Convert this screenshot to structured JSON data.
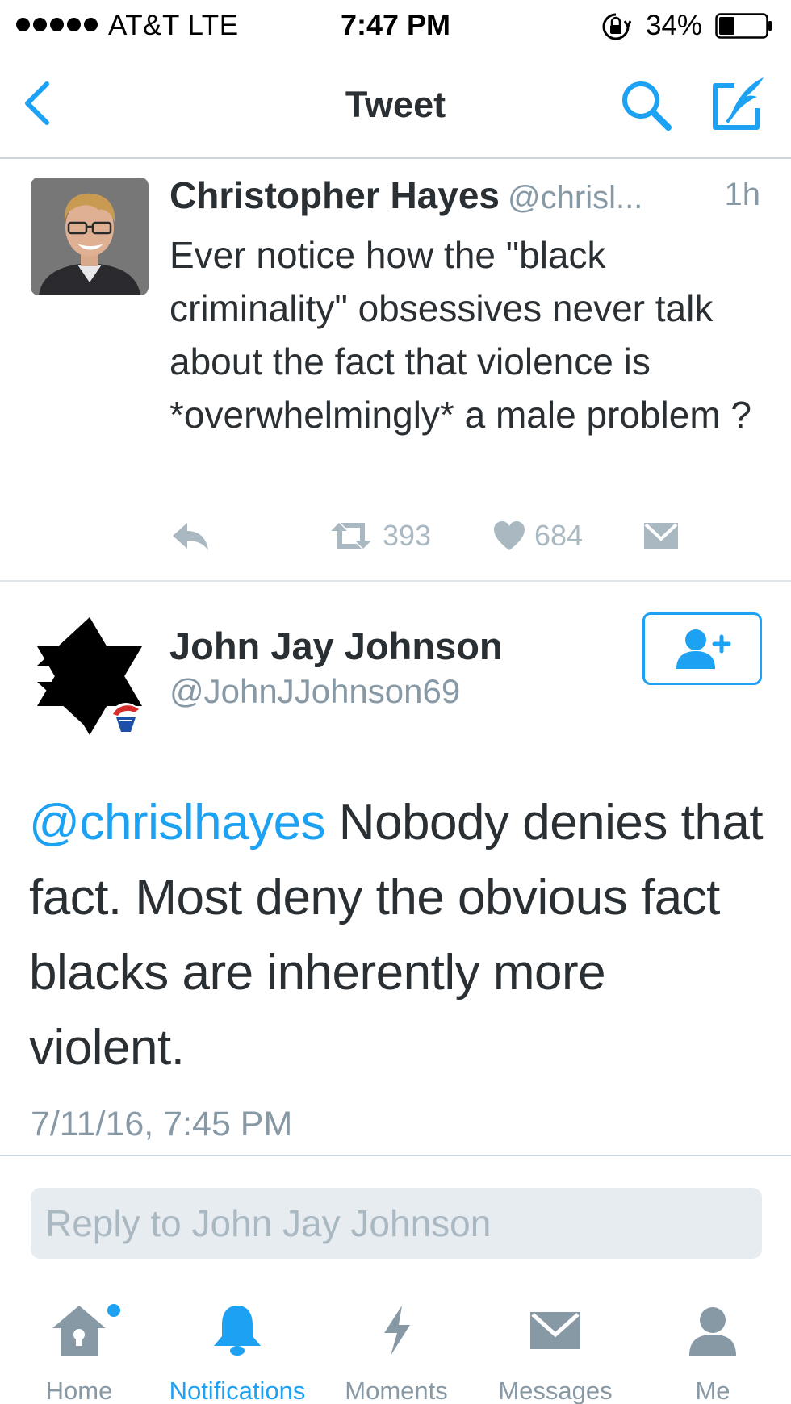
{
  "status_bar": {
    "carrier": "AT&T   LTE",
    "time": "7:47 PM",
    "battery_percent": "34%",
    "battery_level": 0.34,
    "icons": [
      "signal-dots",
      "rotation-lock-icon",
      "battery-icon"
    ]
  },
  "nav": {
    "title": "Tweet",
    "icons": [
      "back-icon",
      "search-icon",
      "compose-icon"
    ]
  },
  "parent_tweet": {
    "name": "Christopher Hayes",
    "handle": "@chrisl...",
    "time": "1h",
    "text": "Ever notice how the \"black criminality\" obsessives never talk about the fact that violence is *overwhelmingly* a male problem ?",
    "retweets": "393",
    "likes": "684",
    "icons": [
      "reply-icon",
      "retweet-icon",
      "heart-icon",
      "envelope-icon"
    ]
  },
  "main_tweet": {
    "name": "John Jay Johnson",
    "handle": "@JohnJJohnson69",
    "mention": "@chrislhayes",
    "text": " Nobody denies that fact.  Most deny the obvious fact blacks are inherently more violent.",
    "timestamp": "7/11/16, 7:45 PM",
    "icons": [
      "follow-icon"
    ]
  },
  "reply": {
    "placeholder": "Reply to John Jay Johnson"
  },
  "tabs": [
    {
      "label": "Home",
      "icon": "home-icon",
      "active": false
    },
    {
      "label": "Notifications",
      "icon": "bell-icon",
      "active": true
    },
    {
      "label": "Moments",
      "icon": "lightning-icon",
      "active": false
    },
    {
      "label": "Messages",
      "icon": "envelope-icon",
      "active": false
    },
    {
      "label": "Me",
      "icon": "person-icon",
      "active": false
    }
  ],
  "colors": {
    "accent": "#1da1f2",
    "text": "#292f33",
    "muted": "#8899a6",
    "icon_gray": "#aab8c2"
  }
}
